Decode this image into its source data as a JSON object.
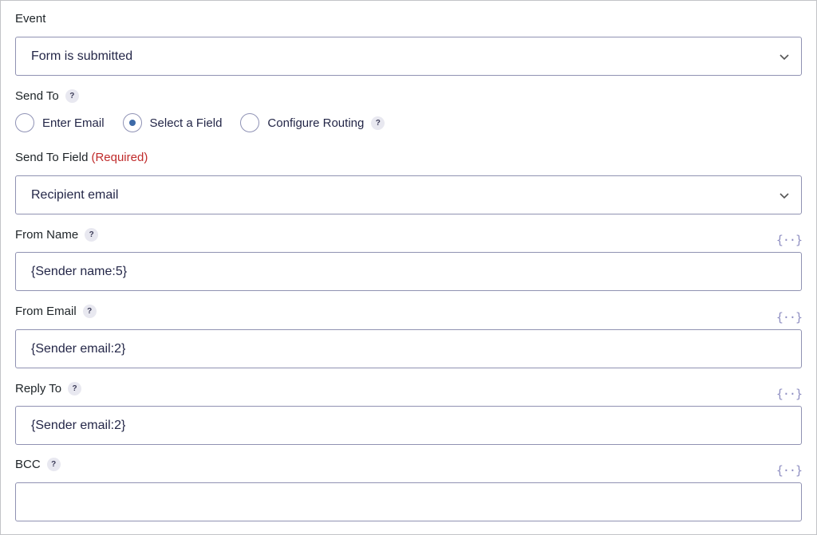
{
  "event": {
    "label": "Event",
    "value": "Form is submitted"
  },
  "send_to": {
    "label": "Send To",
    "help": "?",
    "options": [
      {
        "label": "Enter Email",
        "selected": false
      },
      {
        "label": "Select a Field",
        "selected": true
      },
      {
        "label": "Configure Routing",
        "selected": false
      }
    ],
    "routing_help": "?"
  },
  "send_to_field": {
    "label": "Send To Field",
    "required": "(Required)",
    "value": "Recipient email"
  },
  "from_name": {
    "label": "From Name",
    "help": "?",
    "value": "{Sender name:5}",
    "merge_tag": "{··}"
  },
  "from_email": {
    "label": "From Email",
    "help": "?",
    "value": "{Sender email:2}",
    "merge_tag": "{··}"
  },
  "reply_to": {
    "label": "Reply To",
    "help": "?",
    "value": "{Sender email:2}",
    "merge_tag": "{··}"
  },
  "bcc": {
    "label": "BCC",
    "help": "?",
    "value": "",
    "merge_tag": "{··}"
  },
  "colors": {
    "accent": "#3d6aa8",
    "required": "#c02b2b",
    "border": "#9092b2"
  }
}
